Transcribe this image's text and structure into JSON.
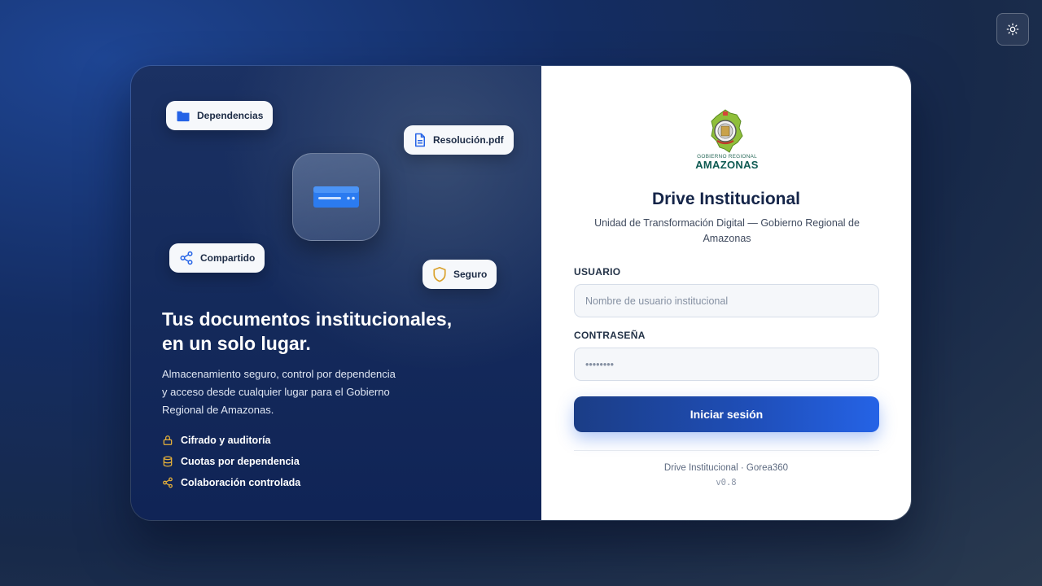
{
  "theme_toggle": {
    "icon": "sun-icon"
  },
  "hero": {
    "chips": [
      {
        "label": "Dependencias",
        "icon": "folder-icon"
      },
      {
        "label": "Resolución.pdf",
        "icon": "file-icon"
      },
      {
        "label": "Compartido",
        "icon": "share-icon"
      },
      {
        "label": "Seguro",
        "icon": "shield-icon"
      }
    ],
    "center_icon": "server-icon",
    "headline_line1": "Tus documentos institucionales,",
    "headline_line2": "en un solo lugar.",
    "description": "Almacenamiento seguro, control por dependencia y acceso desde cualquier lugar para el Gobierno Regional de Amazonas.",
    "features": [
      {
        "label": "Cifrado y auditoría",
        "icon": "lock-icon"
      },
      {
        "label": "Cuotas por dependencia",
        "icon": "database-icon"
      },
      {
        "label": "Colaboración controlada",
        "icon": "share-icon"
      }
    ]
  },
  "login": {
    "logo_top_text": "GOBIERNO REGIONAL",
    "logo_main_text": "AMAZONAS",
    "title": "Drive Institucional",
    "subtitle": "Unidad de Transformación Digital — Gobierno Regional de Amazonas",
    "username_label": "USUARIO",
    "username_placeholder": "Nombre de usuario institucional",
    "username_value": "",
    "password_label": "CONTRASEÑA",
    "password_placeholder": "••••••••",
    "password_value": "",
    "submit_label": "Iniciar sesión",
    "footer_text": "Drive Institucional · Gorea360",
    "version": "v0.8"
  },
  "colors": {
    "accent": "#2563e6",
    "feature_icon": "#e6b13a",
    "title": "#142448"
  }
}
